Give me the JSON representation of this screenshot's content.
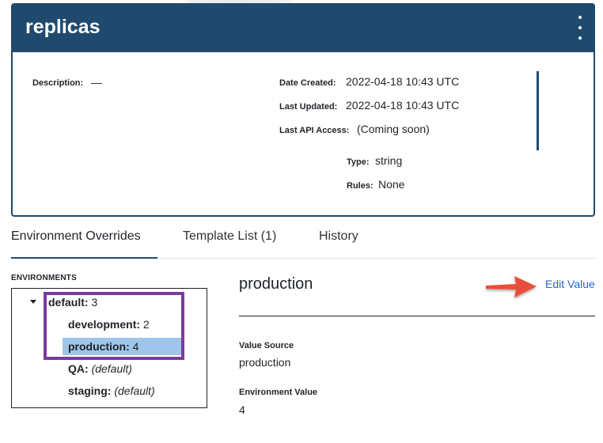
{
  "card": {
    "title": "replicas",
    "menu_icon": "kebab-menu-icon",
    "header_color": "#1f4a6e",
    "description_label": "Description:",
    "description_value": "—",
    "date_created_label": "Date Created:",
    "date_created_value": "2022-04-18 10:43 UTC",
    "last_updated_label": "Last Updated:",
    "last_updated_value": "2022-04-18 10:43 UTC",
    "last_api_label": "Last API Access:",
    "last_api_value": "(Coming soon)",
    "type_label": "Type:",
    "type_value": "string",
    "rules_label": "Rules:",
    "rules_value": "None"
  },
  "tabs": [
    {
      "label": "Environment Overrides",
      "active": true
    },
    {
      "label": "Template List (1)",
      "active": false
    },
    {
      "label": "History",
      "active": false
    }
  ],
  "environments": {
    "heading": "ENVIRONMENTS",
    "root": {
      "name": "default:",
      "value": "3"
    },
    "children": [
      {
        "name": "development:",
        "value": "2"
      },
      {
        "name": "production:",
        "value": "4",
        "selected": true
      },
      {
        "name": "QA:",
        "value": "(default)"
      },
      {
        "name": "staging:",
        "value": "(default)"
      }
    ],
    "selected_color": "#9fc6ea",
    "highlight_color": "#7b3aa0"
  },
  "detail": {
    "title": "production",
    "edit_label": "Edit Value",
    "value_source_label": "Value Source",
    "value_source": "production",
    "env_value_label": "Environment Value",
    "env_value": "4"
  },
  "annotation": {
    "arrow_color": "#e8503a",
    "arrow_icon": "arrow-right-icon"
  }
}
